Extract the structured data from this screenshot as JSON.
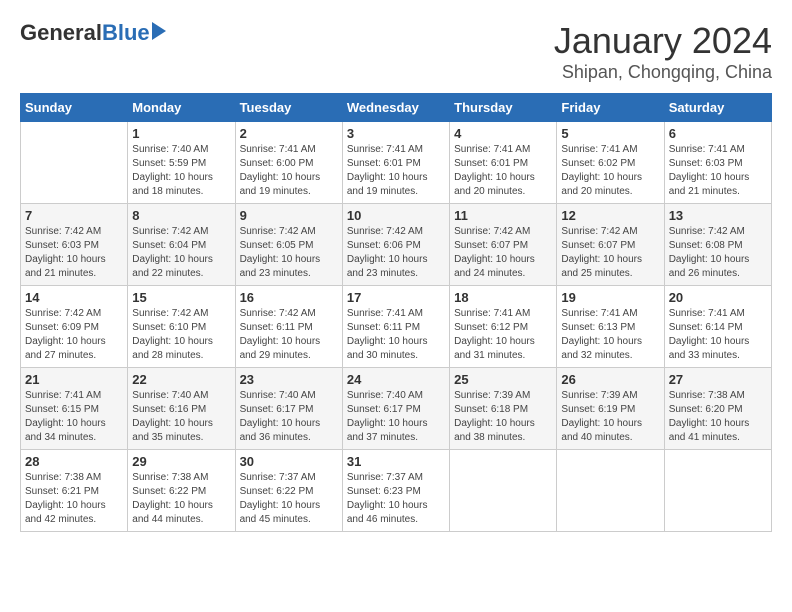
{
  "header": {
    "logo_general": "General",
    "logo_blue": "Blue",
    "main_title": "January 2024",
    "subtitle": "Shipan, Chongqing, China"
  },
  "calendar": {
    "days_of_week": [
      "Sunday",
      "Monday",
      "Tuesday",
      "Wednesday",
      "Thursday",
      "Friday",
      "Saturday"
    ],
    "weeks": [
      [
        {
          "day": "",
          "info": ""
        },
        {
          "day": "1",
          "info": "Sunrise: 7:40 AM\nSunset: 5:59 PM\nDaylight: 10 hours\nand 18 minutes."
        },
        {
          "day": "2",
          "info": "Sunrise: 7:41 AM\nSunset: 6:00 PM\nDaylight: 10 hours\nand 19 minutes."
        },
        {
          "day": "3",
          "info": "Sunrise: 7:41 AM\nSunset: 6:01 PM\nDaylight: 10 hours\nand 19 minutes."
        },
        {
          "day": "4",
          "info": "Sunrise: 7:41 AM\nSunset: 6:01 PM\nDaylight: 10 hours\nand 20 minutes."
        },
        {
          "day": "5",
          "info": "Sunrise: 7:41 AM\nSunset: 6:02 PM\nDaylight: 10 hours\nand 20 minutes."
        },
        {
          "day": "6",
          "info": "Sunrise: 7:41 AM\nSunset: 6:03 PM\nDaylight: 10 hours\nand 21 minutes."
        }
      ],
      [
        {
          "day": "7",
          "info": "Sunrise: 7:42 AM\nSunset: 6:03 PM\nDaylight: 10 hours\nand 21 minutes."
        },
        {
          "day": "8",
          "info": "Sunrise: 7:42 AM\nSunset: 6:04 PM\nDaylight: 10 hours\nand 22 minutes."
        },
        {
          "day": "9",
          "info": "Sunrise: 7:42 AM\nSunset: 6:05 PM\nDaylight: 10 hours\nand 23 minutes."
        },
        {
          "day": "10",
          "info": "Sunrise: 7:42 AM\nSunset: 6:06 PM\nDaylight: 10 hours\nand 23 minutes."
        },
        {
          "day": "11",
          "info": "Sunrise: 7:42 AM\nSunset: 6:07 PM\nDaylight: 10 hours\nand 24 minutes."
        },
        {
          "day": "12",
          "info": "Sunrise: 7:42 AM\nSunset: 6:07 PM\nDaylight: 10 hours\nand 25 minutes."
        },
        {
          "day": "13",
          "info": "Sunrise: 7:42 AM\nSunset: 6:08 PM\nDaylight: 10 hours\nand 26 minutes."
        }
      ],
      [
        {
          "day": "14",
          "info": "Sunrise: 7:42 AM\nSunset: 6:09 PM\nDaylight: 10 hours\nand 27 minutes."
        },
        {
          "day": "15",
          "info": "Sunrise: 7:42 AM\nSunset: 6:10 PM\nDaylight: 10 hours\nand 28 minutes."
        },
        {
          "day": "16",
          "info": "Sunrise: 7:42 AM\nSunset: 6:11 PM\nDaylight: 10 hours\nand 29 minutes."
        },
        {
          "day": "17",
          "info": "Sunrise: 7:41 AM\nSunset: 6:11 PM\nDaylight: 10 hours\nand 30 minutes."
        },
        {
          "day": "18",
          "info": "Sunrise: 7:41 AM\nSunset: 6:12 PM\nDaylight: 10 hours\nand 31 minutes."
        },
        {
          "day": "19",
          "info": "Sunrise: 7:41 AM\nSunset: 6:13 PM\nDaylight: 10 hours\nand 32 minutes."
        },
        {
          "day": "20",
          "info": "Sunrise: 7:41 AM\nSunset: 6:14 PM\nDaylight: 10 hours\nand 33 minutes."
        }
      ],
      [
        {
          "day": "21",
          "info": "Sunrise: 7:41 AM\nSunset: 6:15 PM\nDaylight: 10 hours\nand 34 minutes."
        },
        {
          "day": "22",
          "info": "Sunrise: 7:40 AM\nSunset: 6:16 PM\nDaylight: 10 hours\nand 35 minutes."
        },
        {
          "day": "23",
          "info": "Sunrise: 7:40 AM\nSunset: 6:17 PM\nDaylight: 10 hours\nand 36 minutes."
        },
        {
          "day": "24",
          "info": "Sunrise: 7:40 AM\nSunset: 6:17 PM\nDaylight: 10 hours\nand 37 minutes."
        },
        {
          "day": "25",
          "info": "Sunrise: 7:39 AM\nSunset: 6:18 PM\nDaylight: 10 hours\nand 38 minutes."
        },
        {
          "day": "26",
          "info": "Sunrise: 7:39 AM\nSunset: 6:19 PM\nDaylight: 10 hours\nand 40 minutes."
        },
        {
          "day": "27",
          "info": "Sunrise: 7:38 AM\nSunset: 6:20 PM\nDaylight: 10 hours\nand 41 minutes."
        }
      ],
      [
        {
          "day": "28",
          "info": "Sunrise: 7:38 AM\nSunset: 6:21 PM\nDaylight: 10 hours\nand 42 minutes."
        },
        {
          "day": "29",
          "info": "Sunrise: 7:38 AM\nSunset: 6:22 PM\nDaylight: 10 hours\nand 44 minutes."
        },
        {
          "day": "30",
          "info": "Sunrise: 7:37 AM\nSunset: 6:22 PM\nDaylight: 10 hours\nand 45 minutes."
        },
        {
          "day": "31",
          "info": "Sunrise: 7:37 AM\nSunset: 6:23 PM\nDaylight: 10 hours\nand 46 minutes."
        },
        {
          "day": "",
          "info": ""
        },
        {
          "day": "",
          "info": ""
        },
        {
          "day": "",
          "info": ""
        }
      ]
    ]
  }
}
